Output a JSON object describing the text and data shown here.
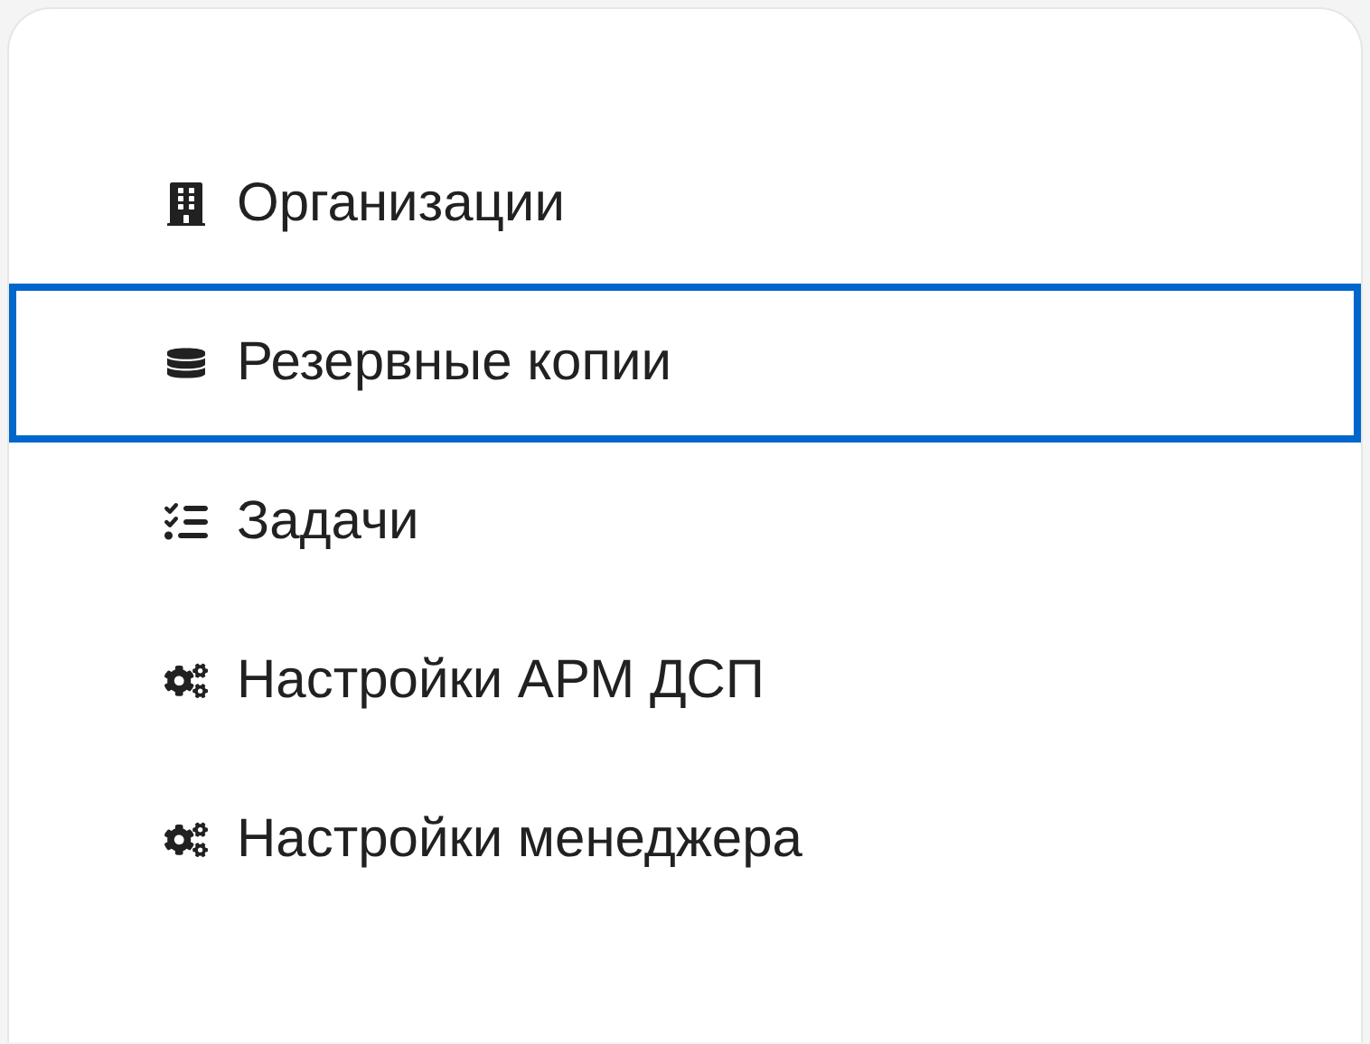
{
  "menu": {
    "items": [
      {
        "label": "Организации",
        "kind": "building",
        "selected": false
      },
      {
        "label": "Резервные копии",
        "kind": "disk",
        "selected": true
      },
      {
        "label": "Задачи",
        "kind": "checklist",
        "selected": false
      },
      {
        "label": "Настройки АРМ ДСП",
        "kind": "gears",
        "selected": false
      },
      {
        "label": "Настройки менеджера",
        "kind": "gears",
        "selected": false
      }
    ]
  }
}
